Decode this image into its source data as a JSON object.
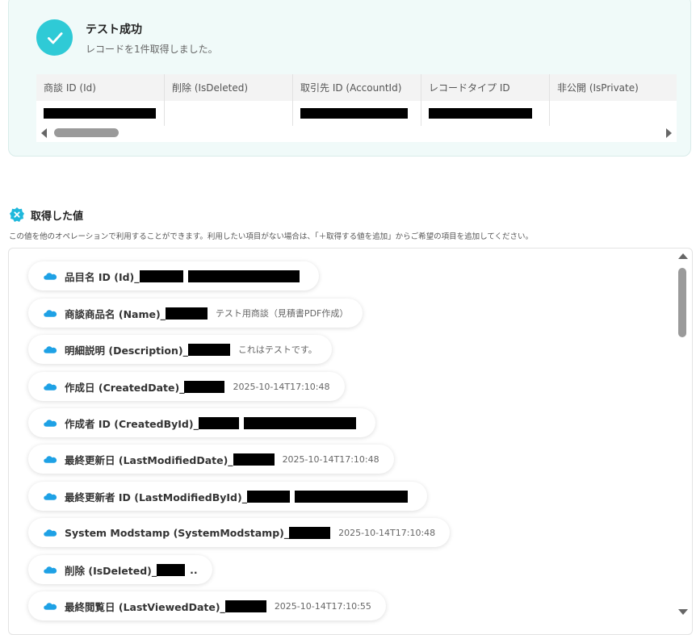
{
  "test_result": {
    "title": "テスト成功",
    "subtitle": "レコードを1件取得しました。",
    "columns": [
      "商談 ID (Id)",
      "削除 (IsDeleted)",
      "取引先 ID (AccountId)",
      "レコードタイプ ID",
      "非公開 (IsPrivate)"
    ],
    "row_redacted": [
      true,
      false,
      true,
      true,
      false
    ]
  },
  "acquired": {
    "title": "取得した値",
    "description": "この値を他のオペレーションで利用することができます。利用したい項目がない場合は、「＋取得する値を追加」からご希望の項目を追加してください。",
    "items": [
      {
        "label": "品目名 ID (Id)_",
        "value": "",
        "value_redacted": true,
        "suffix": ""
      },
      {
        "label": "商談商品名 (Name)_",
        "value": "テスト用商談（見積書PDF作成）",
        "value_redacted": false,
        "suffix": ""
      },
      {
        "label": "明細説明 (Description)_",
        "value": "これはテストです。",
        "value_redacted": false,
        "suffix": ""
      },
      {
        "label": "作成日 (CreatedDate)_",
        "value": "2025-10-14T17:10:48",
        "value_redacted": false,
        "suffix": ""
      },
      {
        "label": "作成者 ID (CreatedById)_",
        "value": "",
        "value_redacted": true,
        "suffix": ""
      },
      {
        "label": "最終更新日 (LastModifiedDate)_",
        "value": "2025-10-14T17:10:48",
        "value_redacted": false,
        "suffix": ""
      },
      {
        "label": "最終更新者 ID (LastModifiedById)_",
        "value": "",
        "value_redacted": true,
        "suffix": ""
      },
      {
        "label": "System Modstamp (SystemModstamp)_",
        "value": "2025-10-14T17:10:48",
        "value_redacted": false,
        "suffix": ""
      },
      {
        "label": "削除 (IsDeleted)_",
        "value": "",
        "value_redacted": false,
        "suffix": ".."
      },
      {
        "label": "最終閲覧日 (LastViewedDate)_",
        "value": "2025-10-14T17:10:55",
        "value_redacted": false,
        "suffix": ""
      }
    ]
  },
  "icons": {
    "success": "check-icon",
    "section": "badge-x-icon",
    "item": "salesforce-cloud-icon"
  },
  "colors": {
    "accent": "#2fcad6",
    "card_bg": "#f0faf9",
    "salesforce": "#1ea1e5"
  }
}
